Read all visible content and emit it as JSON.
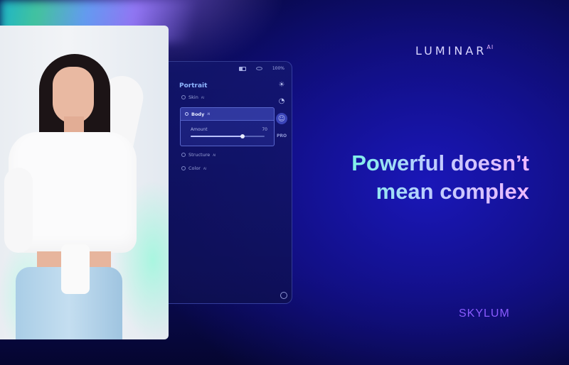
{
  "panel": {
    "zoom": "100%",
    "section_title": "Portrait",
    "tools": [
      {
        "label": "Skin",
        "badge": "AI"
      },
      {
        "label": "Body",
        "badge": "AI"
      },
      {
        "label": "Structure",
        "badge": "AI"
      },
      {
        "label": "Color",
        "badge": "AI"
      }
    ],
    "amount_label": "Amount",
    "amount_value": "70",
    "amount_fraction": 0.7,
    "pro_label": "PRO"
  },
  "brand": {
    "name": "LUMINAR",
    "suffix": "AI"
  },
  "headline": {
    "line1": "Powerful doesn’t",
    "line2": "mean complex"
  },
  "vendor": "SKYLUM"
}
